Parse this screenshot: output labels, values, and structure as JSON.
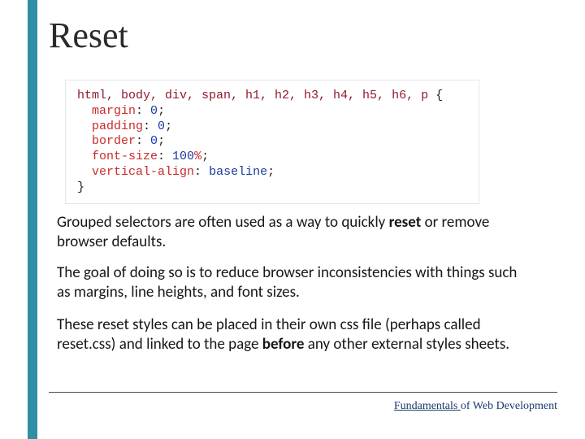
{
  "title": "Reset",
  "code": {
    "selectors": "html, body, div, span, h1, h2, h3, h4, h5, h6, p",
    "open": " {",
    "close": "}",
    "rules": [
      {
        "prop": "margin",
        "val": "0",
        "unit": ""
      },
      {
        "prop": "padding",
        "val": "0",
        "unit": ""
      },
      {
        "prop": "border",
        "val": "0",
        "unit": ""
      },
      {
        "prop": "font-size",
        "val": "100",
        "unit": "%"
      },
      {
        "prop": "vertical-align",
        "val": "baseline",
        "unit": ""
      }
    ]
  },
  "body": {
    "p1_a": "Grouped selectors are often used as a way to quickly ",
    "p1_b": "reset",
    "p1_c": " or remove browser defaults.",
    "p2": "The goal of doing so is to reduce browser inconsistencies with things such as margins, line heights, and font sizes.",
    "p3_a": "These reset styles can be placed in their own css file (perhaps called reset.css) and linked to the page ",
    "p3_b": "before",
    "p3_c": " any other external styles sheets."
  },
  "footer": {
    "a": "Fundamentals ",
    "b": "of Web Development"
  }
}
